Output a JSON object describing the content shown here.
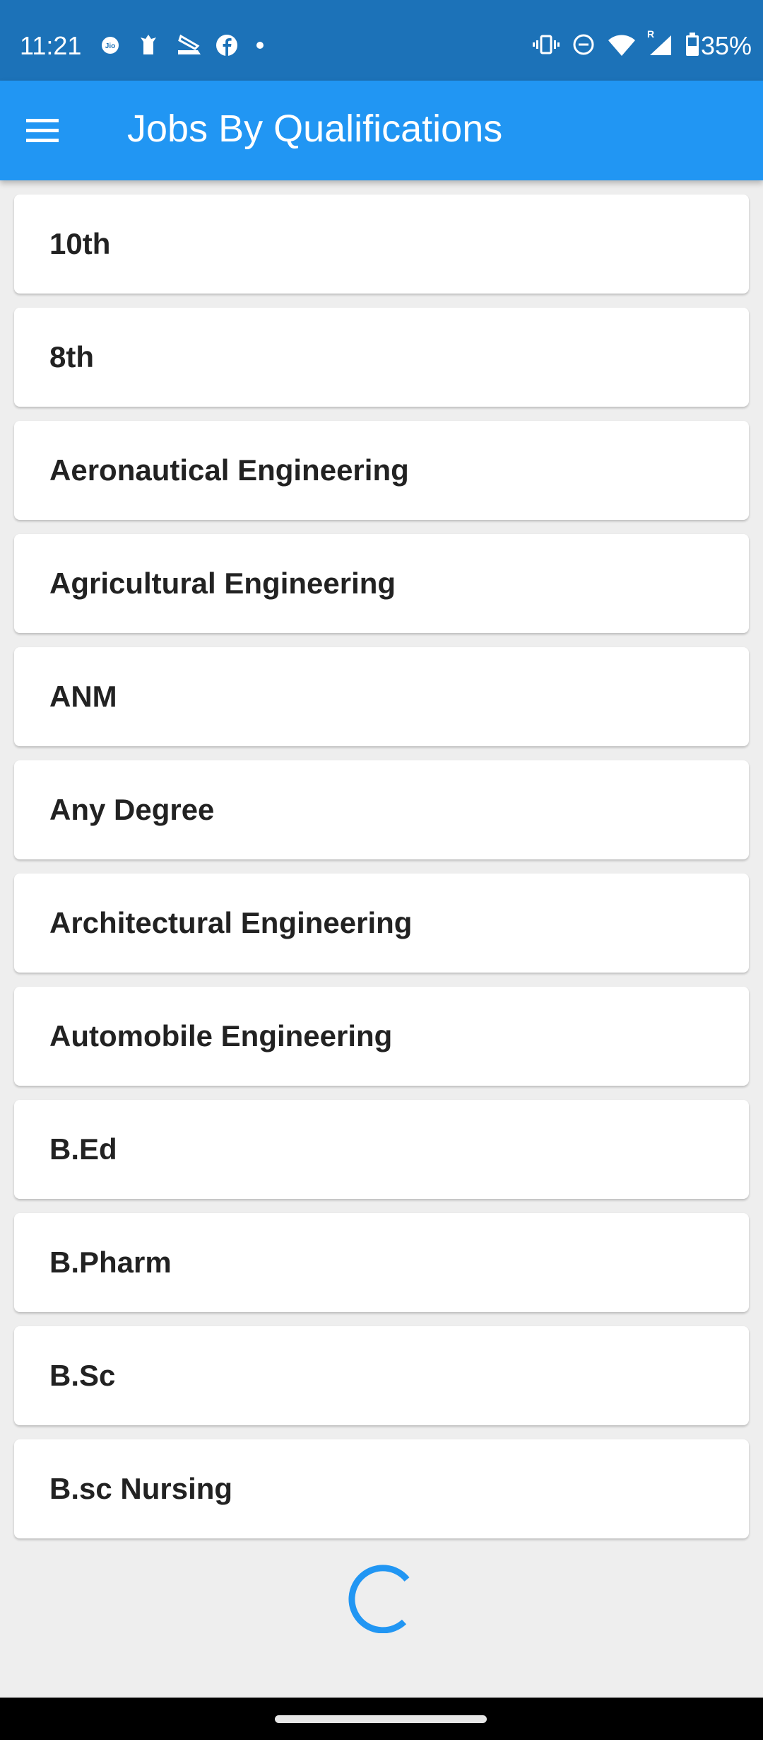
{
  "status_bar": {
    "time": "11:21",
    "left_icons": [
      "jio-icon",
      "emblem-icon",
      "scanner-icon",
      "facebook-icon",
      "dot-icon"
    ],
    "right_icons": [
      "vibrate-icon",
      "dnd-icon",
      "wifi-icon",
      "signal-roaming-icon",
      "battery-icon"
    ],
    "roaming_label": "R",
    "battery_percent": "35%"
  },
  "app_bar": {
    "title": "Jobs By Qualifications",
    "menu_icon": "hamburger-menu-icon"
  },
  "qualifications": [
    {
      "label": "10th"
    },
    {
      "label": "8th"
    },
    {
      "label": "Aeronautical Engineering"
    },
    {
      "label": "Agricultural Engineering"
    },
    {
      "label": "ANM"
    },
    {
      "label": "Any Degree"
    },
    {
      "label": "Architectural Engineering"
    },
    {
      "label": "Automobile Engineering"
    },
    {
      "label": "B.Ed"
    },
    {
      "label": "B.Pharm"
    },
    {
      "label": "B.Sc"
    },
    {
      "label": "B.sc Nursing"
    }
  ],
  "loading": {
    "state": "loading"
  },
  "colors": {
    "status_bar": "#1c72b8",
    "app_bar": "#2196f3",
    "background": "#eeeeee",
    "spinner": "#2196f3",
    "text": "#222222"
  }
}
